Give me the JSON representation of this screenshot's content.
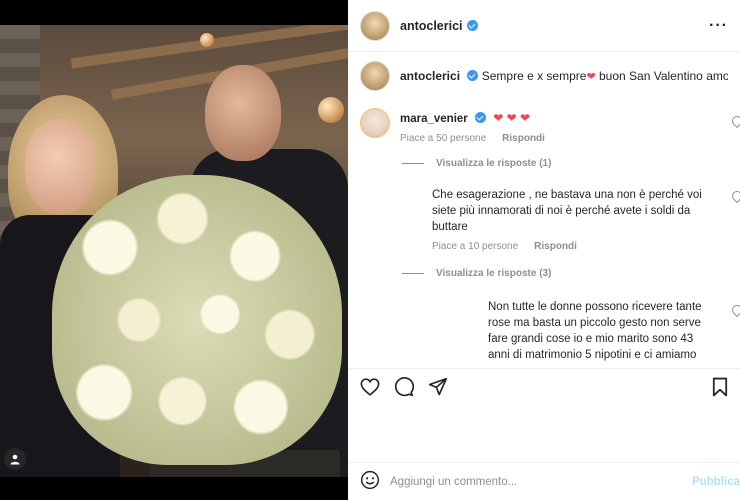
{
  "post": {
    "author": "antoclerici",
    "caption_text": "Sempre e x sempre",
    "caption_heart": "❤",
    "caption_rest": " buon San Valentino amore..."
  },
  "comments": [
    {
      "username": "mara_venier",
      "text": "",
      "hearts": "❤ ❤ ❤",
      "likes": "Piace a 50 persone",
      "reply": "Rispondi",
      "view_replies": "Visualizza le risposte (1)"
    },
    {
      "username": "",
      "text": "Che esagerazione , ne bastava una non è perché voi siete più innamorati di noi è perché avete i soldi da buttare",
      "hearts": "",
      "likes": "Piace a 10 persone",
      "reply": "Rispondi",
      "view_replies": "Visualizza le risposte (3)"
    },
    {
      "username": "",
      "text": "Non tutte le donne possono ricevere tante rose ma basta un piccolo gesto non serve fare grandi cose io e mio marito sono 43 anni di matrimonio 5 nipotini e ci amiamo come due ragazzini",
      "hearts": "❤",
      "likes": "",
      "reply": "",
      "view_replies": ""
    }
  ],
  "composer": {
    "placeholder": "Aggiungi un commento...",
    "publish_label": "Pubblica"
  },
  "icons": {
    "like": "heart-icon",
    "comment": "comment-icon",
    "share": "share-icon",
    "save": "bookmark-icon",
    "emoji": "emoji-icon",
    "more": "more-icon",
    "tag": "user-tag-icon"
  },
  "colors": {
    "verified": "#3897f0",
    "heart": "#ed4956",
    "publish": "#b2dffc",
    "meta_text": "#8e8e8e"
  }
}
